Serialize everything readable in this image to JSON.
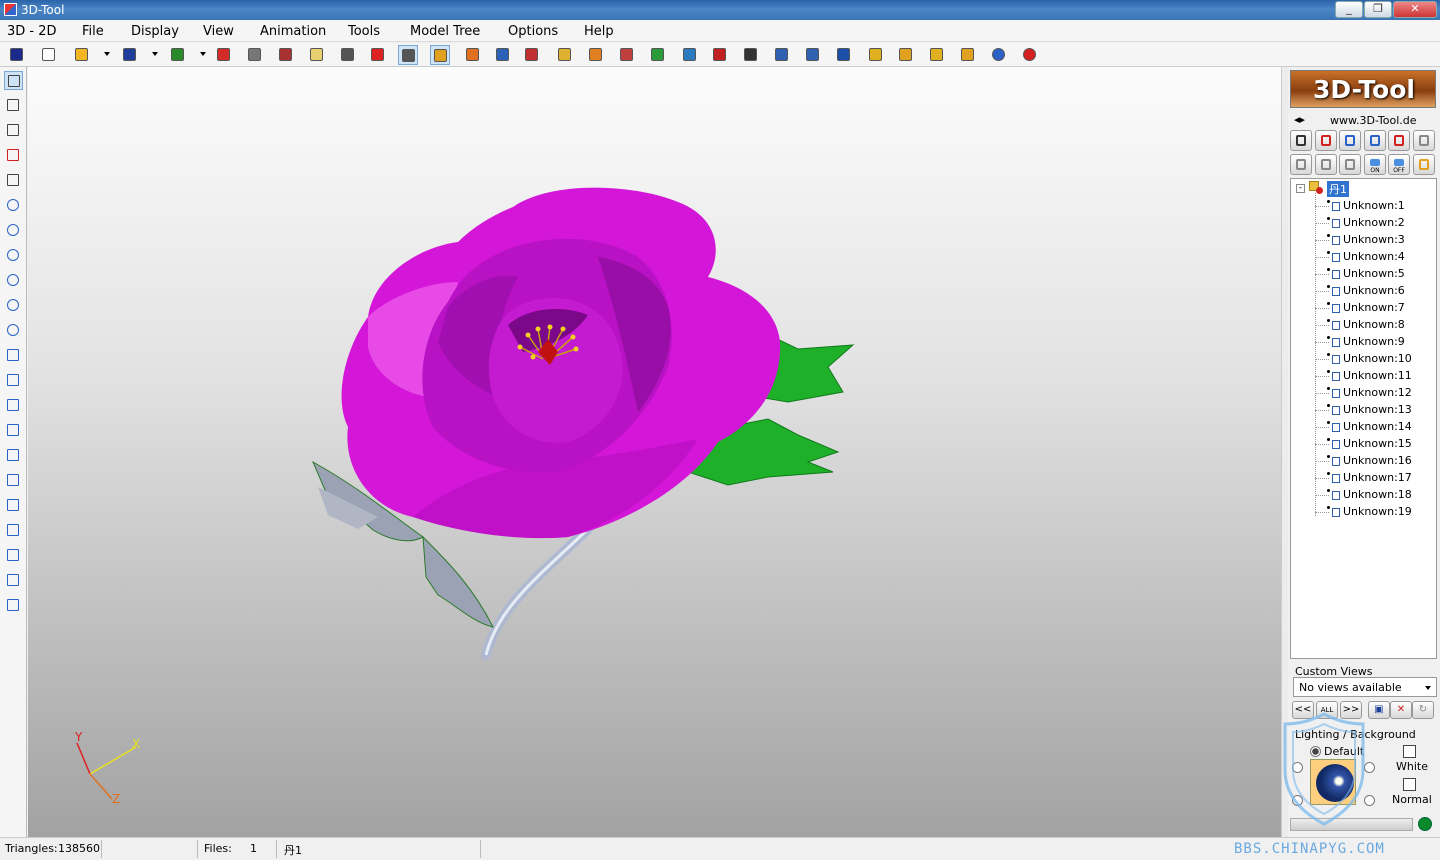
{
  "window": {
    "title": "3D-Tool",
    "buttons": [
      "_",
      "❐",
      "✕"
    ]
  },
  "menu": [
    "3D - 2D",
    "File",
    "Display",
    "View",
    "Animation",
    "Tools",
    "Model Tree",
    "Options",
    "Help"
  ],
  "toolbar": [
    {
      "name": "3d-2d-icon",
      "color": "#1a2a8c"
    },
    {
      "name": "new-icon",
      "color": "#ffffff"
    },
    {
      "name": "open-icon",
      "color": "#f2b623"
    },
    {
      "name": "save-icon",
      "color": "#1d3f9a"
    },
    {
      "name": "exe-export-icon",
      "color": "#2a8a2a"
    },
    {
      "name": "pdf-icon",
      "color": "#d42a2a"
    },
    {
      "name": "print-icon",
      "color": "#777777"
    },
    {
      "name": "pic-icon",
      "color": "#a83232"
    },
    {
      "name": "clipboard-icon",
      "color": "#e8d070"
    },
    {
      "name": "measure-icon",
      "color": "#555555"
    },
    {
      "name": "section-icon",
      "color": "#d22"
    },
    {
      "name": "section-active-icon",
      "color": "#555555"
    },
    {
      "name": "ruler-active-icon",
      "color": "#e0a020"
    },
    {
      "name": "explode-icon",
      "color": "#e07020"
    },
    {
      "name": "comment-icon",
      "color": "#2a62b8"
    },
    {
      "name": "pencil-icon",
      "color": "#c03030"
    },
    {
      "name": "ruler-icon",
      "color": "#e0b030"
    },
    {
      "name": "dimension-icon",
      "color": "#e08020"
    },
    {
      "name": "paint-icon",
      "color": "#c04040"
    },
    {
      "name": "transform-icon",
      "color": "#2a9a3a"
    },
    {
      "name": "chart-icon",
      "color": "#2a7ac0"
    },
    {
      "name": "align-icon",
      "color": "#c02020"
    },
    {
      "name": "film-icon",
      "color": "#333333"
    },
    {
      "name": "camera-icon",
      "color": "#3060b0"
    },
    {
      "name": "camera2-icon",
      "color": "#3060b0"
    },
    {
      "name": "info-icon",
      "color": "#1a50a8"
    },
    {
      "name": "move-icon",
      "color": "#e0b020"
    },
    {
      "name": "rotate-icon",
      "color": "#e0a020"
    },
    {
      "name": "play-icon",
      "color": "#e0b020"
    },
    {
      "name": "mirror-icon",
      "color": "#e0a020"
    },
    {
      "name": "help-icon",
      "color": "#2a62c8"
    },
    {
      "name": "exit-icon",
      "color": "#d42020"
    }
  ],
  "lefttools": [
    "select-icon",
    "box-view-icon",
    "box-iso-icon",
    "box-red-icon",
    "box-front-icon",
    "zoom-in-icon",
    "zoom-out-icon",
    "zoom-fit-icon",
    "zoom-window-icon",
    "pan-icon",
    "orbit-icon",
    "view-front-icon",
    "view-back-icon",
    "view-left-icon",
    "view-right-icon",
    "view-top-icon",
    "view-bottom-icon",
    "view-iso-icon",
    "view-custom-icon",
    "rotate-180h-icon",
    "rotate-180v-icon",
    "rotate-90n-icon"
  ],
  "panel": {
    "logo": "3D-Tool",
    "url": "www.3D-Tool.de",
    "buttons_row1": [
      "eye-icon",
      "hide-icon",
      "select-all-icon",
      "doc-icon",
      "doc-delete-icon",
      "refresh-icon"
    ],
    "buttons_row2": [
      "box-outline-icon",
      "box-solid-icon",
      "box-transparent-icon",
      "on-icon",
      "off-icon",
      "face-icon"
    ],
    "on_label": "ON",
    "off_label": "OFF",
    "root": "丹1",
    "nodes": [
      "Unknown:1",
      "Unknown:2",
      "Unknown:3",
      "Unknown:4",
      "Unknown:5",
      "Unknown:6",
      "Unknown:7",
      "Unknown:8",
      "Unknown:9",
      "Unknown:10",
      "Unknown:11",
      "Unknown:12",
      "Unknown:13",
      "Unknown:14",
      "Unknown:15",
      "Unknown:16",
      "Unknown:17",
      "Unknown:18",
      "Unknown:19"
    ],
    "custom_views_label": "Custom Views",
    "custom_views_value": "No views available",
    "cv_buttons": [
      "<<",
      "ALL",
      ">>"
    ],
    "lighting_label": "Lighting / Background",
    "default_label": "Default",
    "white_label": "White",
    "normal_label": "Normal"
  },
  "axes": {
    "x": "X",
    "y": "Y",
    "z": "Z"
  },
  "status": {
    "triangles_label": "Triangles:",
    "triangles_value": "138560",
    "files_label": "Files:",
    "files_value": "1",
    "model_name": "丹1",
    "watermark": "BBS.CHINAPYG.COM"
  },
  "colors": {
    "petal": "#d416d8",
    "petal_dark": "#8a0a94",
    "leaf": "#1fb02a",
    "stem": "#aeb8d0"
  }
}
